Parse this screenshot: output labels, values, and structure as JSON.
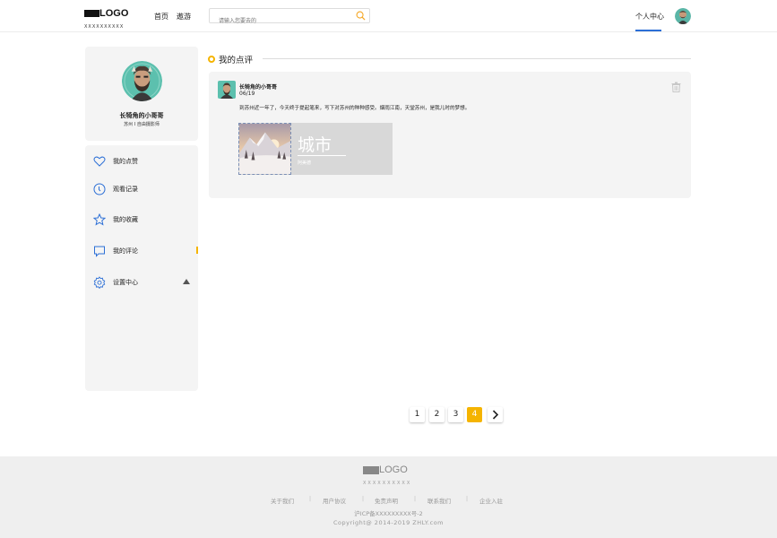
{
  "header": {
    "logo_text": "LOGO",
    "logo_sub": "XXXXXXXXXX",
    "nav": [
      "首页",
      "遨游"
    ],
    "search_placeholder": "请输入您要去的",
    "user_center": "个人中心"
  },
  "profile": {
    "name": "长犄角的小哥哥",
    "desc": "苏州 I 自由摄影师"
  },
  "menu": [
    {
      "label": "我的点赞",
      "icon": "heart-icon"
    },
    {
      "label": "观看记录",
      "icon": "clock-icon"
    },
    {
      "label": "我的收藏",
      "icon": "star-icon"
    },
    {
      "label": "我的评论",
      "icon": "comment-icon"
    },
    {
      "label": "设置中心",
      "icon": "settings-icon"
    }
  ],
  "section": {
    "title": "我的点评"
  },
  "comment": {
    "author": "长犄角的小哥哥",
    "date": "06/19",
    "text": "到苏州近一年了，今天终于提起笔来，写下对苏州的种种感受。烟雨江南，天堂苏州，是我儿时的梦想。",
    "attachment": {
      "title": "城市",
      "subtitle": "阿美德"
    }
  },
  "pagination": {
    "pages": [
      "1",
      "2",
      "3",
      "4"
    ],
    "active": 4,
    "next": "›"
  },
  "footer": {
    "logo_text": "LOGO",
    "logo_sub": "XXXXXXXXXX",
    "links": [
      "关于我们",
      "用户协议",
      "免责声明",
      "联系我们",
      "企业入驻"
    ],
    "icp": "沪ICP备XXXXXXXXX号-2",
    "copyright": "Copyright@ 2014-2019 ZHLY.com"
  },
  "colors": {
    "accent": "#f5b400",
    "nav_blue": "#2c6fd6",
    "icon_blue": "#2c6fd6"
  }
}
